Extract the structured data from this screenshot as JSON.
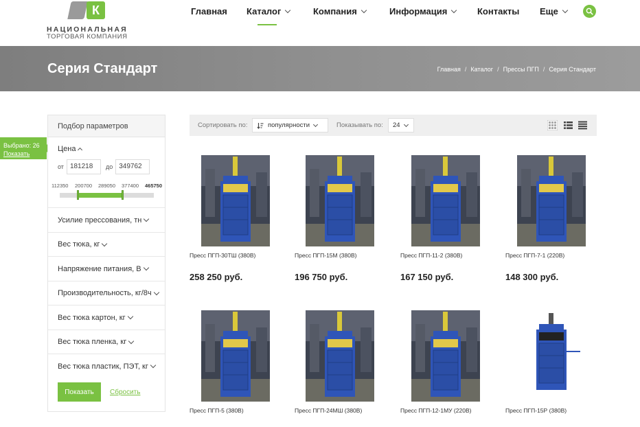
{
  "logo": {
    "mark_letter": "К",
    "line1": "НАЦИОНАЛЬНАЯ",
    "line2": "ТОРГОВАЯ КОМПАНИЯ"
  },
  "nav": {
    "items": [
      {
        "label": "Главная",
        "dropdown": false
      },
      {
        "label": "Каталог",
        "dropdown": true
      },
      {
        "label": "Компания",
        "dropdown": true
      },
      {
        "label": "Информация",
        "dropdown": true
      },
      {
        "label": "Контакты",
        "dropdown": false
      },
      {
        "label": "Еще",
        "dropdown": true
      }
    ],
    "search_icon": "search-icon",
    "accent": "#7ac142"
  },
  "banner": {
    "title": "Серия Стандарт",
    "breadcrumb": [
      "Главная",
      "Каталог",
      "Прессы ПГП",
      "Серия Стандарт"
    ]
  },
  "selected": {
    "label": "Выбрано: 26",
    "link": "Показать"
  },
  "filter": {
    "title": "Подбор параметров",
    "price_label": "Цена",
    "from_label": "от",
    "from_value": "181218",
    "to_label": "до",
    "to_value": "349762",
    "scale": [
      "112350",
      "200700",
      "289050",
      "377400",
      "465750"
    ],
    "range_min": 112350,
    "range_max": 465750,
    "selected_min": 181218,
    "selected_max": 349762,
    "sections": [
      "Усилие прессования, тн",
      "Вес тюка, кг",
      "Напряжение питания, В",
      "Производительность, кг/8ч",
      "Вес тюка картон, кг",
      "Вес тюка пленка, кг",
      "Вес тюка пластик, ПЭТ, кг"
    ],
    "show_button": "Показать",
    "reset_link": "Сбросить"
  },
  "toolbar": {
    "sort_label": "Сортировать по:",
    "sort_value": "популярности",
    "per_page_label": "Показывать по:",
    "per_page_value": "24",
    "views": [
      "grid-view-icon",
      "list-view-icon",
      "table-view-icon"
    ]
  },
  "products": [
    {
      "name": "Пресс ПГП-30ТШ (380В)",
      "price": "258 250 руб."
    },
    {
      "name": "Пресс ПГП-15М (380В)",
      "price": "196 750 руб."
    },
    {
      "name": "Пресс ПГП-11-2 (380В)",
      "price": "167 150 руб."
    },
    {
      "name": "Пресс ПГП-7-1 (220В)",
      "price": "148 300 руб."
    },
    {
      "name": "Пресс ПГП-5 (380В)",
      "price": ""
    },
    {
      "name": "Пресс ПГП-24МШ (380В)",
      "price": ""
    },
    {
      "name": "Пресс ПГП-12-1МУ (220В)",
      "price": ""
    },
    {
      "name": "Пресс ПГП-15Р (380В)",
      "price": ""
    }
  ]
}
